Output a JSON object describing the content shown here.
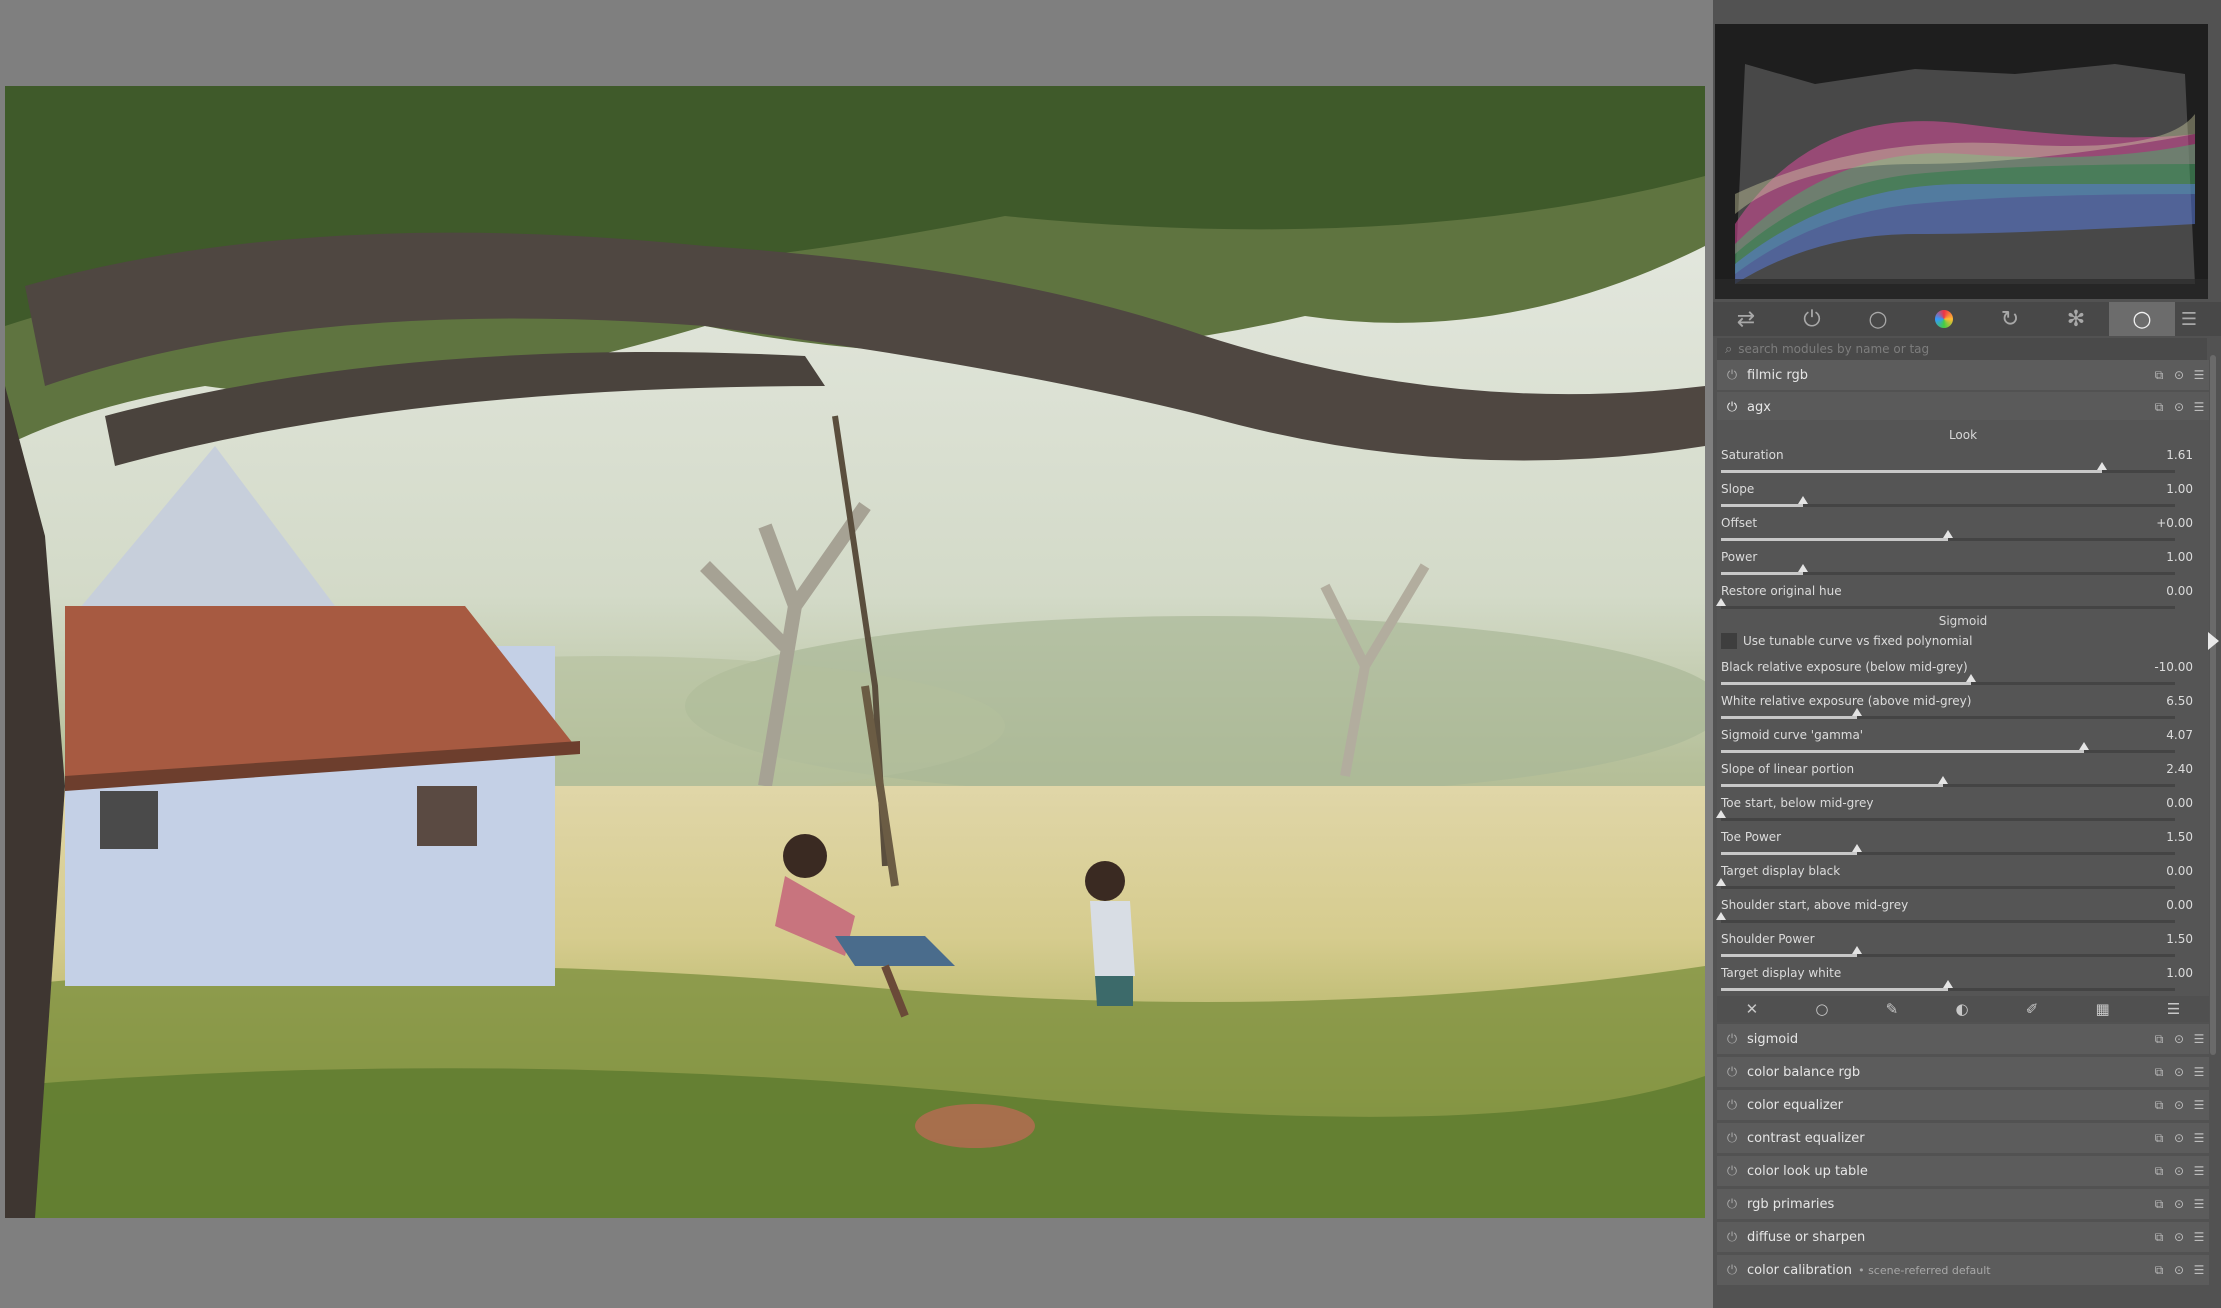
{
  "search": {
    "placeholder": "search modules by name or tag"
  },
  "tabs": [
    {
      "icon": "sliders-icon"
    },
    {
      "icon": "power-icon"
    },
    {
      "icon": "circle-icon"
    },
    {
      "icon": "color-wheel-icon"
    },
    {
      "icon": "correct-icon"
    },
    {
      "icon": "effects-icon"
    },
    {
      "icon": "group-circle-icon"
    }
  ],
  "modules_top": [
    {
      "name": "filmic rgb"
    },
    {
      "name": "agx"
    }
  ],
  "agx": {
    "look_label": "Look",
    "sigmoid_label": "Sigmoid",
    "checkbox_label": "Use tunable curve vs fixed polynomial",
    "sliders_look": [
      {
        "label": "Saturation",
        "value": "1.61",
        "pos": 0.84
      },
      {
        "label": "Slope",
        "value": "1.00",
        "pos": 0.18
      },
      {
        "label": "Offset",
        "value": "+0.00",
        "pos": 0.5
      },
      {
        "label": "Power",
        "value": "1.00",
        "pos": 0.18
      },
      {
        "label": "Restore original hue",
        "value": "0.00",
        "pos": 0.0
      }
    ],
    "sliders_sigmoid": [
      {
        "label": "Black relative exposure (below mid-grey)",
        "value": "-10.00",
        "pos": 0.55
      },
      {
        "label": "White relative exposure (above mid-grey)",
        "value": "6.50",
        "pos": 0.3
      },
      {
        "label": "Sigmoid curve 'gamma'",
        "value": "4.07",
        "pos": 0.8
      },
      {
        "label": "Slope of linear portion",
        "value": "2.40",
        "pos": 0.49
      },
      {
        "label": "Toe start, below mid-grey",
        "value": "0.00",
        "pos": 0.0
      },
      {
        "label": "Toe Power",
        "value": "1.50",
        "pos": 0.3
      },
      {
        "label": "Target display black",
        "value": "0.00",
        "pos": 0.0
      },
      {
        "label": "Shoulder start, above mid-grey",
        "value": "0.00",
        "pos": 0.0
      },
      {
        "label": "Shoulder Power",
        "value": "1.50",
        "pos": 0.3
      },
      {
        "label": "Target display white",
        "value": "1.00",
        "pos": 0.5
      }
    ]
  },
  "modules_bottom": [
    {
      "name": "sigmoid",
      "sub": ""
    },
    {
      "name": "color balance rgb",
      "sub": ""
    },
    {
      "name": "color equalizer",
      "sub": ""
    },
    {
      "name": "contrast equalizer",
      "sub": ""
    },
    {
      "name": "color look up table",
      "sub": ""
    },
    {
      "name": "rgb primaries",
      "sub": ""
    },
    {
      "name": "diffuse or sharpen",
      "sub": ""
    },
    {
      "name": "color calibration",
      "sub": "• scene-referred default"
    }
  ]
}
